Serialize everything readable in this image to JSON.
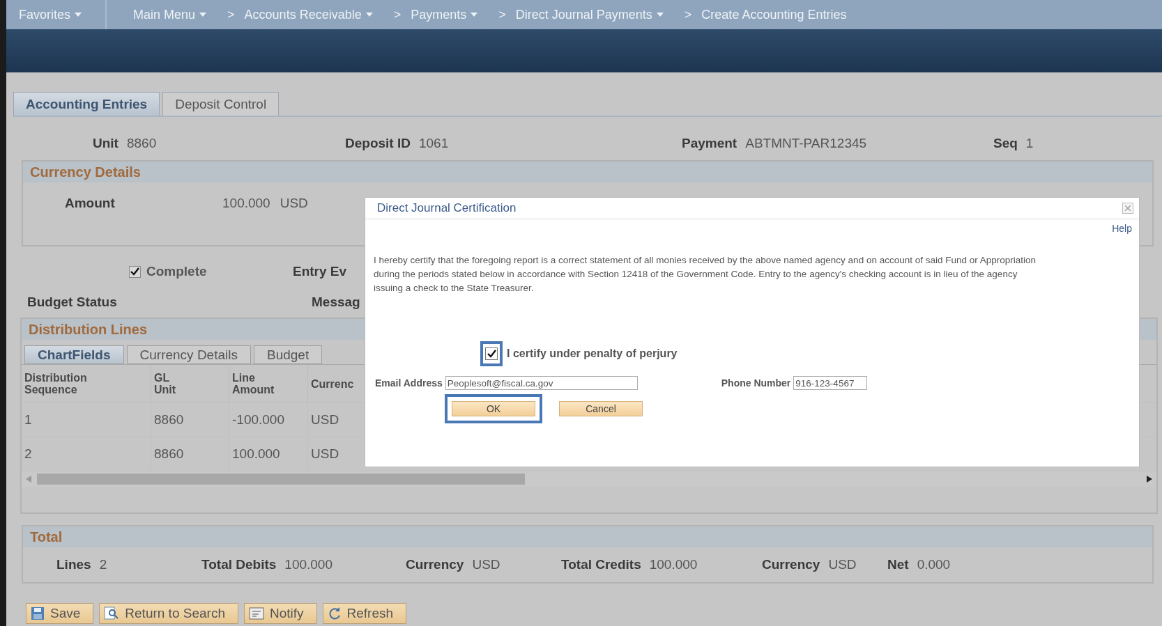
{
  "nav": {
    "items": [
      {
        "label": "Favorites",
        "dropdown": true
      },
      {
        "label": "Main Menu",
        "dropdown": true
      },
      {
        "label": "Accounts Receivable",
        "dropdown": true,
        "separator": ">"
      },
      {
        "label": "Payments",
        "dropdown": true,
        "separator": ">"
      },
      {
        "label": "Direct Journal Payments",
        "dropdown": true,
        "separator": ">"
      },
      {
        "label": "Create Accounting Entries",
        "dropdown": false,
        "separator": ">"
      }
    ]
  },
  "page_tabs": [
    {
      "label": "Accounting Entries",
      "selected": true
    },
    {
      "label": "Deposit Control",
      "selected": false
    }
  ],
  "header_fields": [
    {
      "label": "Unit",
      "value": "8860"
    },
    {
      "label": "Deposit ID",
      "value": "1061"
    },
    {
      "label": "Payment",
      "value": "ABTMNT-PAR12345"
    },
    {
      "label": "Seq",
      "value": "1"
    }
  ],
  "currency_details": {
    "title": "Currency Details",
    "amount_label": "Amount",
    "amount": "100.000",
    "currency": "USD"
  },
  "complete": {
    "label": "Complete",
    "checked": true
  },
  "entry_event_label": "Entry Ev",
  "budget_status_label": "Budget Status",
  "message_label": "Messag",
  "distribution": {
    "title": "Distribution Lines",
    "tabs": [
      {
        "label": "ChartFields",
        "selected": true
      },
      {
        "label": "Currency Details",
        "selected": false
      },
      {
        "label": "Budget",
        "selected": false
      }
    ],
    "columns": [
      "Distribution Sequence",
      "GL Unit",
      "Line Amount",
      "Currenc"
    ],
    "rows": [
      [
        "1",
        "8860",
        "-100.000",
        "USD"
      ],
      [
        "2",
        "8860",
        "100.000",
        "USD"
      ]
    ]
  },
  "total": {
    "title": "Total",
    "fields": [
      {
        "label": "Lines",
        "value": "2"
      },
      {
        "label": "Total Debits",
        "value": "100.000"
      },
      {
        "label": "Currency",
        "value": "USD"
      },
      {
        "label": "Total Credits",
        "value": "100.000"
      },
      {
        "label": "Currency",
        "value": "USD"
      },
      {
        "label": "Net",
        "value": "0.000"
      }
    ]
  },
  "buttons": [
    {
      "label": "Save",
      "kind": "save"
    },
    {
      "label": "Return to Search",
      "kind": "search"
    },
    {
      "label": "Notify",
      "kind": "notify"
    },
    {
      "label": "Refresh",
      "kind": "refresh"
    }
  ],
  "dialog": {
    "title": "Direct Journal Certification",
    "help": "Help",
    "text": "I hereby certify that the foregoing report is a correct statement of all monies received by the above named agency and on account of said Fund or Appropriation during the periods stated below in accordance with Section 12418 of the Government Code. Entry to the agency's checking account is in lieu of the agency issuing a check to the State Treasurer.",
    "certify": {
      "label": "I certify under penalty of perjury",
      "checked": true,
      "highlighted": true
    },
    "email": {
      "label": "Email Address",
      "value": "Peoplesoft@fiscal.ca.gov"
    },
    "phone": {
      "label": "Phone Number",
      "value": "916-123-4567"
    },
    "buttons": [
      {
        "label": "OK",
        "highlighted": true
      },
      {
        "label": "Cancel",
        "highlighted": false
      }
    ]
  }
}
